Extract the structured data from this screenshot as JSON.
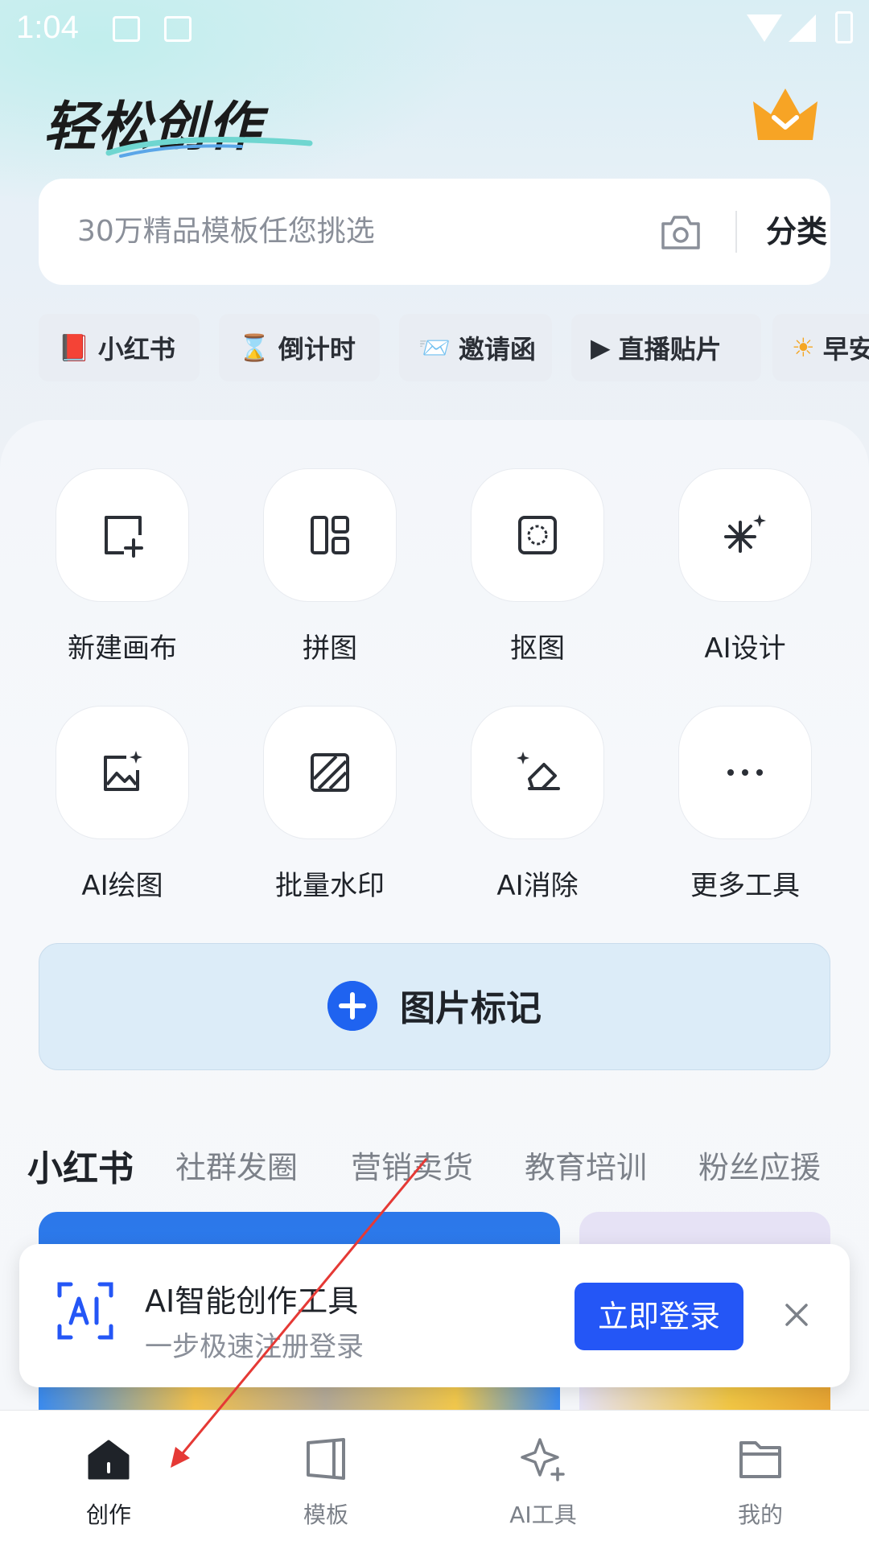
{
  "status_bar": {
    "time": "1:04"
  },
  "header": {
    "title": "轻松创作"
  },
  "search": {
    "placeholder": "30万精品模板任您挑选",
    "category_label": "分类"
  },
  "chips": [
    {
      "emoji": "📕",
      "label": "小红书"
    },
    {
      "emoji": "⌛",
      "label": "倒计时"
    },
    {
      "emoji": "📨",
      "label": "邀请函"
    },
    {
      "emoji": "▶",
      "label": "直播贴片"
    },
    {
      "emoji": "☀",
      "label": "早安"
    }
  ],
  "tools": [
    {
      "label": "新建画布",
      "icon": "new-canvas-icon"
    },
    {
      "label": "拼图",
      "icon": "collage-icon"
    },
    {
      "label": "抠图",
      "icon": "cutout-icon"
    },
    {
      "label": "AI设计",
      "icon": "ai-design-icon"
    },
    {
      "label": "AI绘图",
      "icon": "ai-drawing-icon"
    },
    {
      "label": "批量水印",
      "icon": "batch-watermark-icon"
    },
    {
      "label": "AI消除",
      "icon": "ai-eraser-icon"
    },
    {
      "label": "更多工具",
      "icon": "more-icon"
    }
  ],
  "mark_banner": {
    "label": "图片标记"
  },
  "category_tabs": [
    "小红书",
    "社群发圈",
    "营销卖货",
    "教育培训",
    "粉丝应援"
  ],
  "login_toast": {
    "title": "AI智能创作工具",
    "subtitle": "一步极速注册登录",
    "button": "立即登录"
  },
  "bottom_nav": [
    {
      "label": "创作",
      "icon": "home-icon",
      "active": true
    },
    {
      "label": "模板",
      "icon": "template-icon",
      "active": false
    },
    {
      "label": "AI工具",
      "icon": "ai-sparkle-icon",
      "active": false
    },
    {
      "label": "我的",
      "icon": "folder-icon",
      "active": false
    }
  ],
  "colors": {
    "accent": "#2456f6",
    "plus_button": "#1f63f0",
    "vip_orange": "#f5a623",
    "annotation_arrow": "#e53935"
  }
}
